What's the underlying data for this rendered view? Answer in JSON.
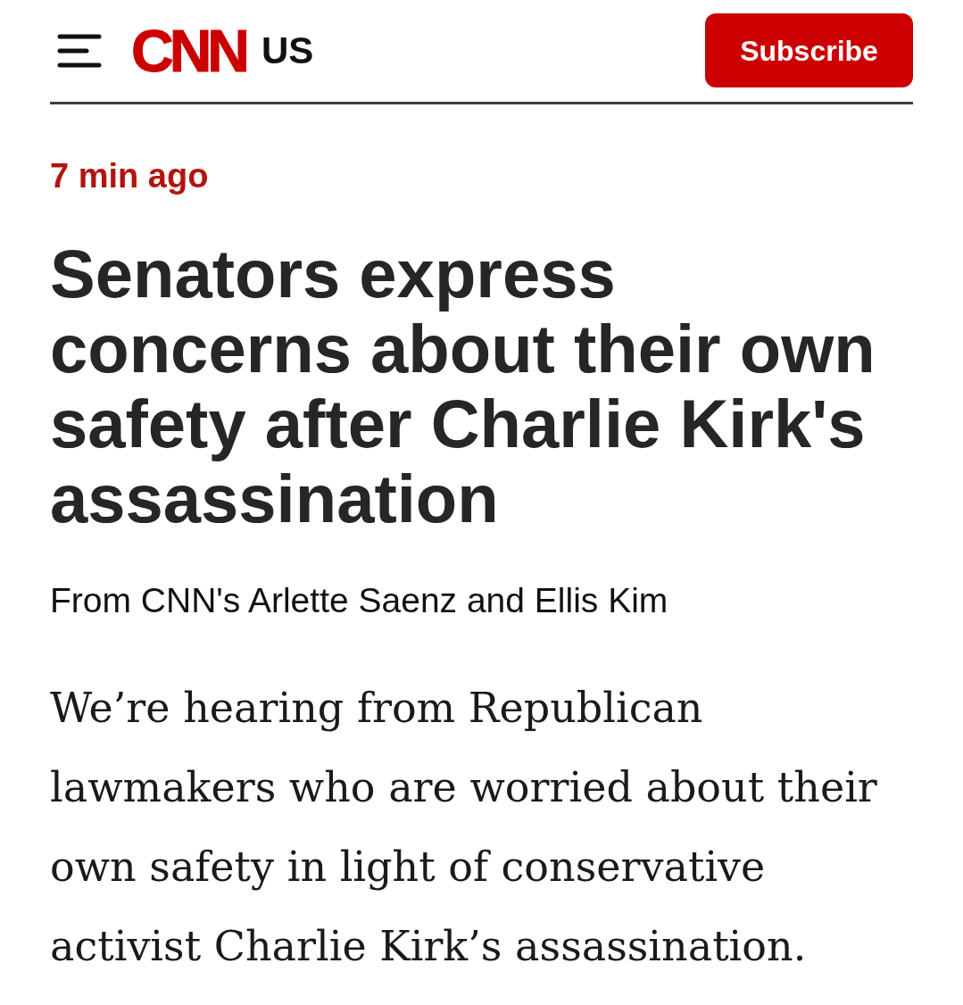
{
  "header": {
    "logo": "CNN",
    "edition": "US",
    "subscribe_button": "Subscribe"
  },
  "post": {
    "timestamp": "7 min ago",
    "headline": "Senators express concerns about their own safety after Charlie Kirk's assassination",
    "byline": "From CNN's Arlette Saenz and Ellis Kim",
    "body": "We’re hearing from Republican lawmakers who are worried about their own safety in light of conservative activist Charlie Kirk’s assassination."
  }
}
